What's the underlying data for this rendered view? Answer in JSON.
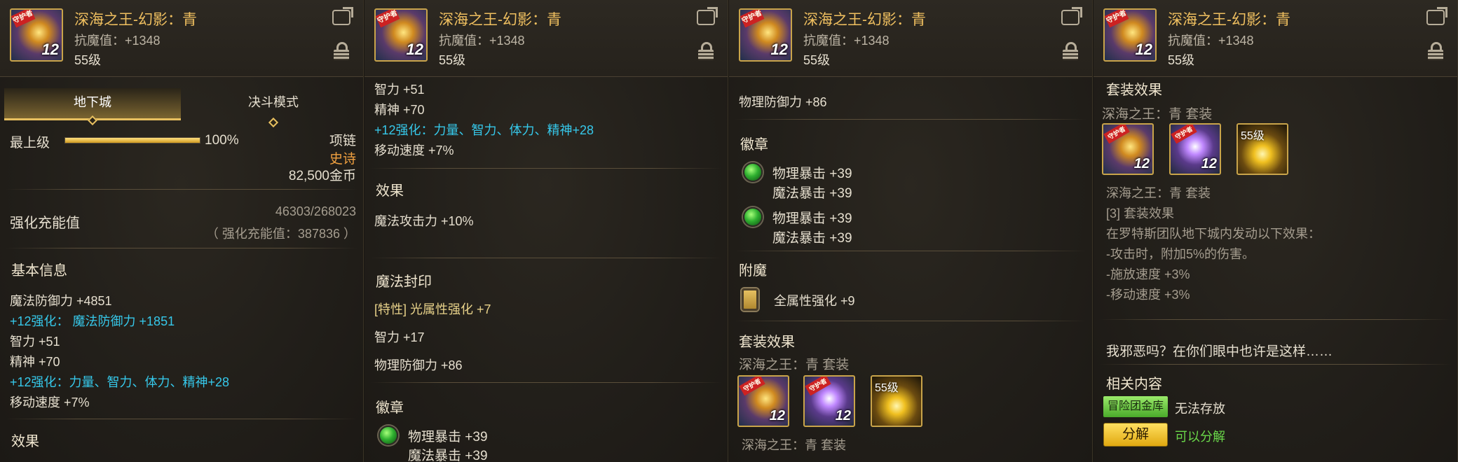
{
  "header": {
    "title": "深海之王-幻影：青",
    "resist": "抗魔值：+1348",
    "level": "55级",
    "icon_tag": "守护者",
    "icon_level": "12"
  },
  "panel1": {
    "tabs": [
      "地下城",
      "决斗模式"
    ],
    "grade": "最上级",
    "grade_percent": 100,
    "grade_percent_text": "100%",
    "slot": "项链",
    "rarity": "史诗",
    "price": "82,500金币",
    "reinforce_label": "强化充能值",
    "reinforce_value": "46303/268023",
    "reinforce_total": "（ 强化充能值：387836 ）",
    "basic_title": "基本信息",
    "stats": [
      "魔法防御力 +4851"
    ],
    "stat_plus": "+12强化：  魔法防御力 +1851",
    "stats2": [
      "智力 +51",
      "精神 +70"
    ],
    "stat_plus2": "+12强化：力量、智力、体力、精神+28",
    "stats3": [
      "移动速度 +7%"
    ],
    "effect_title": "效果"
  },
  "panel2": {
    "stats": [
      "智力 +51",
      "精神 +70"
    ],
    "stat_plus": "+12强化：力量、智力、体力、精神+28",
    "stat_move": "移动速度 +7%",
    "effect_title": "效果",
    "effect_text": "魔法攻击力 +10%",
    "seal_title": "魔法封印",
    "seal_trait": "[特性] 光属性强化 +7",
    "seal_int": "智力 +17",
    "seal_def": "物理防御力 +86",
    "emblem_title": "徽章",
    "emblem_1a": "物理暴击 +39",
    "emblem_1b": "魔法暴击 +39"
  },
  "panel3": {
    "def": "物理防御力 +86",
    "emblem_title": "徽章",
    "emblems": [
      {
        "a": "物理暴击 +39",
        "b": "魔法暴击 +39"
      },
      {
        "a": "物理暴击 +39",
        "b": "魔法暴击 +39"
      }
    ],
    "enchant_title": "附魔",
    "enchant_text": "全属性强化 +9",
    "set_title": "套装效果",
    "set_name": "深海之王：青 套装",
    "set_icon_level": "55级",
    "set_name2": "深海之王：青 套装"
  },
  "panel4": {
    "set_title": "套装效果",
    "set_name": "深海之王：青 套装",
    "set_icon_level": "55级",
    "set_name2": "深海之王：青 套装",
    "set_count": "[3] 套装效果",
    "set_desc": "在罗特斯团队地下城内发动以下效果：",
    "set_lines": [
      "-攻击时，附加5%的伤害。",
      "-施放速度 +3%",
      "-移动速度 +3%"
    ],
    "flavor": "我邪恶吗？在你们眼中也许是这样……",
    "related_title": "相关内容",
    "storage_btn": "冒险团金库",
    "storage_text": "无法存放",
    "disassemble_btn": "分解",
    "disassemble_text": "可以分解"
  }
}
